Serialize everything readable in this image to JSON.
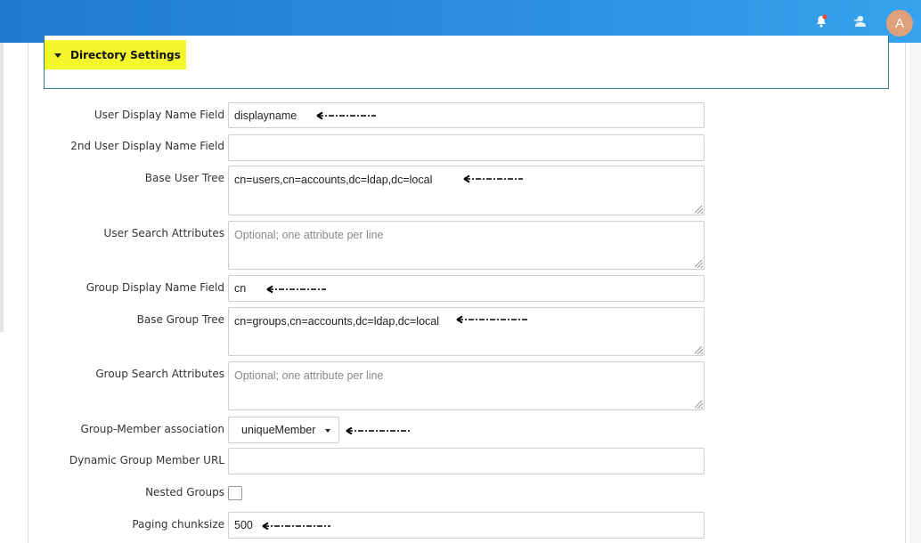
{
  "topbar": {
    "icons": [
      "bell-alert-icon",
      "user-switch-icon"
    ],
    "avatar_initial": "A",
    "colors": {
      "bar": "#2b8ee0",
      "avatar": "#e0a07a",
      "alert_dot": "#e84a2f"
    }
  },
  "section": {
    "title": "Directory Settings",
    "highlight_color": "#f4f72d",
    "border_color": "#2e7d86"
  },
  "form": {
    "user_display_name_field": {
      "label": "User Display Name Field",
      "value": "displayname"
    },
    "second_user_display_name_field": {
      "label": "2nd User Display Name Field",
      "value": ""
    },
    "base_user_tree": {
      "label": "Base User Tree",
      "value": "cn=users,cn=accounts,dc=ldap,dc=local"
    },
    "user_search_attributes": {
      "label": "User Search Attributes",
      "placeholder": "Optional; one attribute per line"
    },
    "group_display_name_field": {
      "label": "Group Display Name Field",
      "value": "cn"
    },
    "base_group_tree": {
      "label": "Base Group Tree",
      "value": "cn=groups,cn=accounts,dc=ldap,dc=local"
    },
    "group_search_attributes": {
      "label": "Group Search Attributes",
      "placeholder": "Optional; one attribute per line"
    },
    "group_member_association": {
      "label": "Group-Member association",
      "selected": "uniqueMember"
    },
    "dynamic_group_member_url": {
      "label": "Dynamic Group Member URL",
      "value": ""
    },
    "nested_groups": {
      "label": "Nested Groups",
      "checked": false
    },
    "paging_chunksize": {
      "label": "Paging chunksize",
      "value": "500"
    }
  }
}
